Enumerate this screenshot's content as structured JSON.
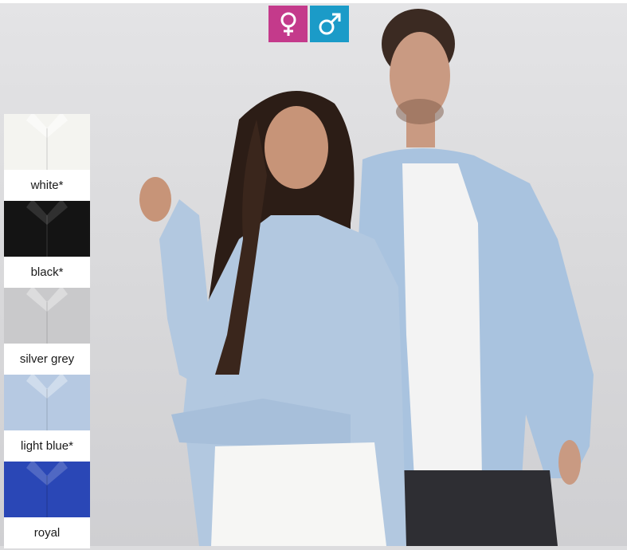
{
  "gender_icons": [
    {
      "name": "female",
      "color": "#c43a8b",
      "icon": "female-symbol-icon"
    },
    {
      "name": "male",
      "color": "#1b9bc8",
      "icon": "male-symbol-icon"
    }
  ],
  "swatches": [
    {
      "label": "white*",
      "color": "#f4f4f0"
    },
    {
      "label": "black*",
      "color": "#141414"
    },
    {
      "label": "silver grey",
      "color": "#c9c9cb"
    },
    {
      "label": "light blue*",
      "color": "#b6c9e2"
    },
    {
      "label": "royal",
      "color": "#2a47b6"
    }
  ]
}
